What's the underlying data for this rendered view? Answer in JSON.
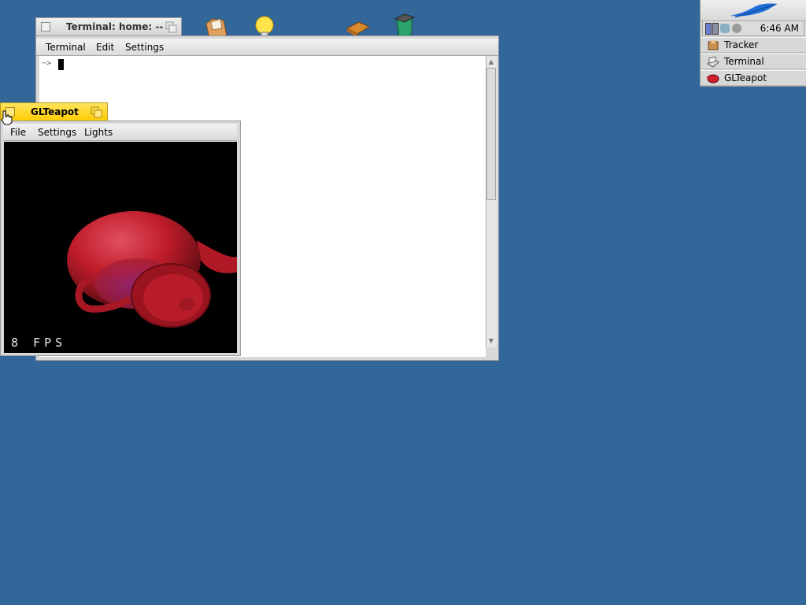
{
  "desktop": {
    "background_color": "#336699",
    "icons": [
      "folder-icon",
      "lightbulb-icon",
      "package-icon",
      "trash-icon"
    ]
  },
  "deskbar": {
    "clock": "6:46 AM",
    "leaf_icon": "haiku-leaf-icon",
    "apps": [
      {
        "label": "Tracker",
        "icon": "tracker-icon"
      },
      {
        "label": "Terminal",
        "icon": "terminal-icon"
      },
      {
        "label": "GLTeapot",
        "icon": "teapot-icon"
      }
    ]
  },
  "terminal": {
    "title": "Terminal: home: --",
    "menu": [
      "Terminal",
      "Edit",
      "Settings"
    ],
    "prompt": "~>"
  },
  "glteapot": {
    "title": "GLTeapot",
    "menu": [
      "File",
      "Settings",
      "Lights"
    ],
    "fps": "8 FPS",
    "teapot_color": "#c8202c"
  }
}
